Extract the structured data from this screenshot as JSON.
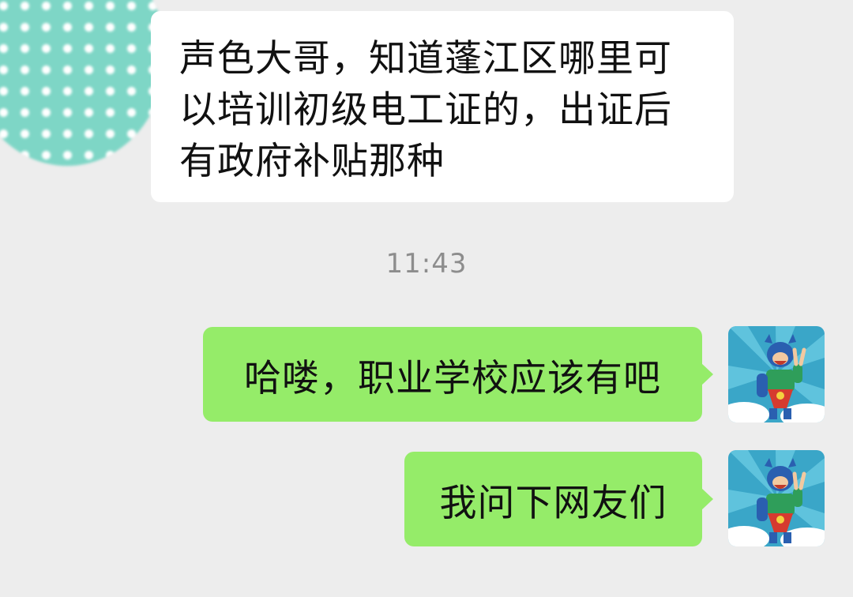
{
  "chat": {
    "messages": [
      {
        "direction": "incoming",
        "lines": [
          "声色大哥，知道蓬江区哪里可",
          "以培训初级电工证的，出证后",
          "有政府补贴那种"
        ],
        "bubble_color": "#ffffff"
      },
      {
        "direction": "timestamp",
        "text": "11:43"
      },
      {
        "direction": "outgoing",
        "text": "哈喽，职业学校应该有吧",
        "bubble_color": "#95ec69"
      },
      {
        "direction": "outgoing",
        "text": "我问下网友们",
        "bubble_color": "#95ec69"
      }
    ],
    "colors": {
      "background": "#ededed",
      "incoming_avatar_base": "#7ed6c6",
      "timestamp_text": "#8d8d8d"
    },
    "icons": {
      "incoming_avatar": "polka-dot-avatar-icon",
      "outgoing_avatar": "cartoon-superhero-avatar-icon"
    }
  }
}
